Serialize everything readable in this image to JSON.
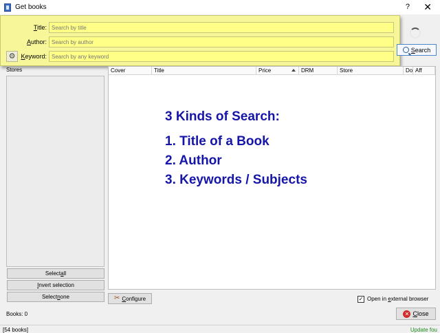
{
  "window": {
    "title": "Get books",
    "help_label": "?",
    "close_label": "✕"
  },
  "search": {
    "title_label_u": "T",
    "title_label_rest": "itle:",
    "title_placeholder": "Search by title",
    "author_label_u": "A",
    "author_label_rest": "uthor:",
    "author_placeholder": "Search by author",
    "keyword_label_u": "K",
    "keyword_label_rest": "eyword:",
    "keyword_placeholder": "Search by any keyword",
    "button_u": "S",
    "button_rest": "earch"
  },
  "stores": {
    "label": "Stores",
    "select_all_pre": "Select ",
    "select_all_u": "a",
    "select_all_post": "ll",
    "invert_u": "I",
    "invert_post": "nvert selection",
    "select_none_pre": "Select ",
    "select_none_u": "n",
    "select_none_post": "one"
  },
  "columns": [
    "Cover",
    "Title",
    "Price",
    "DRM",
    "Store",
    "Do",
    "Aff"
  ],
  "annotation": {
    "heading": "3 Kinds of Search:",
    "items": [
      "1.  Title of a Book",
      "2.  Author",
      "3.  Keywords / Subjects"
    ]
  },
  "configure": {
    "u": "C",
    "rest": "onfigure"
  },
  "open_external": {
    "checked": true,
    "pre": "Open in ",
    "u": "e",
    "post": "xternal browser"
  },
  "footer": {
    "books_count": "Books:  0",
    "close_u": "C",
    "close_rest": "lose"
  },
  "status": {
    "left": "[54 books]",
    "right": "Update fou"
  },
  "colors": {
    "search_panel": "#f7f79a",
    "annotation_text": "#1515a8",
    "status_right": "#1b8a1b"
  }
}
